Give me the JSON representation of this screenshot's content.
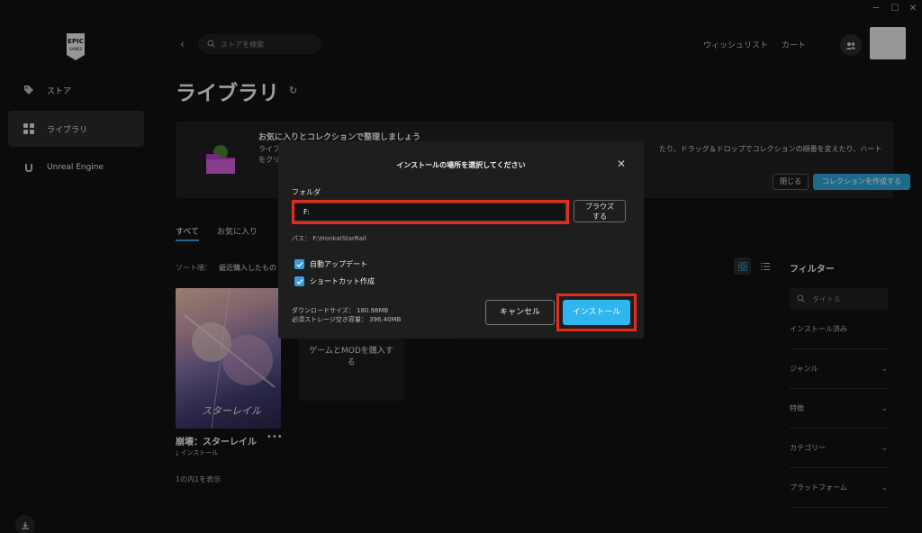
{
  "window_controls": [
    "─",
    "☐",
    "✕"
  ],
  "logo": {
    "text": "EPIC GAMES"
  },
  "sidebar": {
    "items": [
      {
        "label": "ストア",
        "icon": "tag-icon"
      },
      {
        "label": "ライブラリ",
        "icon": "grid-icon"
      },
      {
        "label": "Unreal Engine",
        "icon": "unreal-icon"
      }
    ]
  },
  "header": {
    "search_placeholder": "ストアを検索",
    "wishlist": "ウィッシュリスト",
    "cart": "カート"
  },
  "page": {
    "title": "ライブラリ"
  },
  "banner": {
    "title": "お気に入りとコレクションで整理しましょう",
    "text1": "ライブ",
    "text1_right": "たり、ドラッグ＆ドロップでコレクションの順番を変えたり、ハート",
    "text2": "をクリ",
    "close_label": "閉じる",
    "create_label": "コレクションを作成する"
  },
  "tabs": [
    {
      "label": "すべて",
      "active": true
    },
    {
      "label": "お気に入り",
      "active": false
    }
  ],
  "sort": {
    "label": "ソート順：",
    "value": "最近購入したもの"
  },
  "games": [
    {
      "name": "崩壊：スターレイル",
      "more": "•••",
      "sub": "インストール",
      "art_text": "スターレイル"
    }
  ],
  "buy_card": {
    "line1": "ゲームとMODを購入す",
    "line2": "る"
  },
  "count_text": "1の内1を表示",
  "filters": {
    "title": "フィルター",
    "search_placeholder": "タイトル",
    "rows": [
      {
        "label": "インストール済み",
        "chevron": false
      },
      {
        "label": "ジャンル",
        "chevron": true
      },
      {
        "label": "特徴",
        "chevron": true
      },
      {
        "label": "カテゴリー",
        "chevron": true
      },
      {
        "label": "プラットフォーム",
        "chevron": true
      }
    ]
  },
  "dialog": {
    "title": "インストールの場所を選択してください",
    "folder_label": "フォルダ",
    "folder_value": "F:",
    "browse_line1": "ブラウズ",
    "browse_line2": "する",
    "path": "パス：  F:\\HonkaiStarRail",
    "checkboxes": [
      {
        "label": "自動アップデート",
        "checked": true
      },
      {
        "label": "ショートカット作成",
        "checked": true
      }
    ],
    "download_size": "ダウンロードサイズ： 180.98MB",
    "required_storage": "必須ストレージ空き容量： 396.40MB",
    "cancel_label": "キャンセル",
    "install_label": "インストール"
  },
  "colors": {
    "accent": "#2ea3d8",
    "install_button": "#2fb6ef",
    "highlight": "#e82a1a",
    "background": "#121212"
  }
}
